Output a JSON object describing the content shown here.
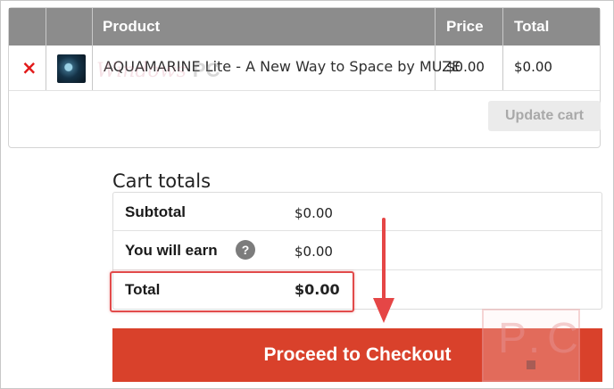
{
  "cart": {
    "headers": {
      "remove": "",
      "thumbnail": "",
      "product": "Product",
      "price": "Price",
      "total": "Total"
    },
    "items": [
      {
        "remove_icon": "×",
        "thumbnail": "product-thumbnail",
        "name": "AQUAMARINE Lite - A New Way to Space by MUZE",
        "price": "$0.00",
        "total": "$0.00"
      }
    ],
    "update_label": "Update cart"
  },
  "totals": {
    "title": "Cart totals",
    "subtotal_label": "Subtotal",
    "subtotal_value": "$0.00",
    "earn_label": "You will earn",
    "earn_help": "?",
    "earn_value": "$0.00",
    "total_label": "Total",
    "total_value": "$0.00"
  },
  "checkout_label": "Proceed to Checkout",
  "watermark": {
    "script": "Windows",
    "letters": "PC",
    "logo": "P.C"
  },
  "colors": {
    "header_bg": "#8c8c8c",
    "remove": "#e21a1a",
    "checkout_bg": "#d9412b",
    "annotation": "#e54646"
  }
}
